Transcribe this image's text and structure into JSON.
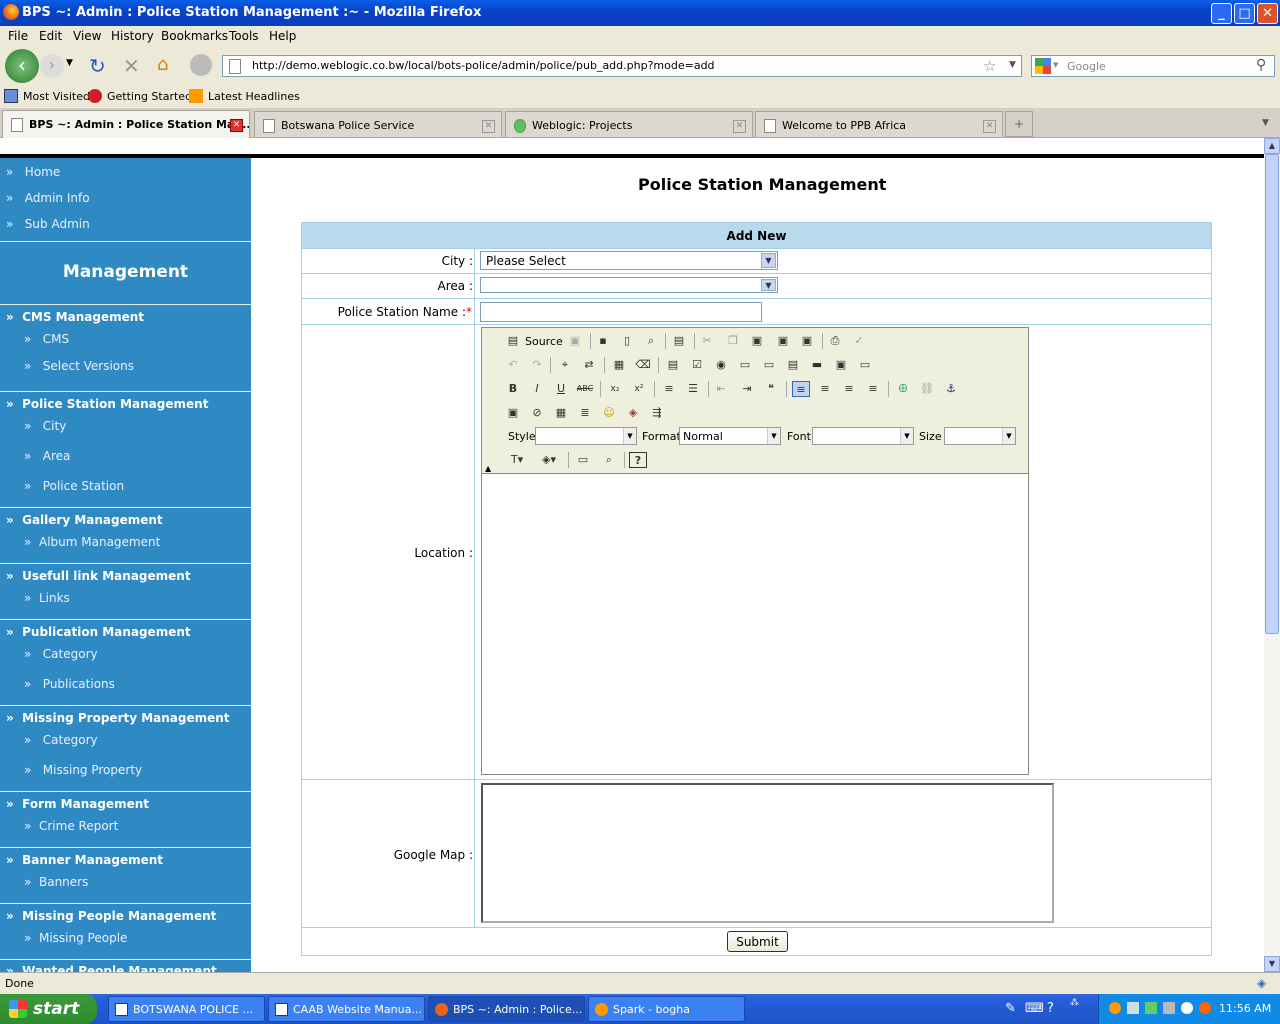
{
  "window": {
    "title": "BPS ~: Admin : Police Station Management :~ - Mozilla Firefox"
  },
  "menu": [
    "File",
    "Edit",
    "View",
    "History",
    "Bookmarks",
    "Tools",
    "Help"
  ],
  "address": {
    "url": "http://demo.weblogic.co.bw/local/bots-police/admin/police/pub_add.php?mode=add",
    "search_placeholder": "Google"
  },
  "bookmarks": [
    "Most Visited",
    "Getting Started",
    "Latest Headlines"
  ],
  "tabs": [
    "BPS ~: Admin : Police Station Man...",
    "Botswana Police Service",
    "Weblogic: Projects",
    "Welcome to PPB Africa"
  ],
  "sidebar": {
    "top": [
      "Home",
      "Admin Info",
      "Sub Admin"
    ],
    "heading": "Management",
    "sections": [
      {
        "title": "CMS Management",
        "items": [
          "CMS",
          "Select Versions"
        ]
      },
      {
        "title": "Police Station Management",
        "items": [
          "City",
          "Area",
          "Police Station"
        ]
      },
      {
        "title": "Gallery Management",
        "items": [
          "Album Management"
        ]
      },
      {
        "title": "Usefull link Management",
        "items": [
          "Links"
        ]
      },
      {
        "title": "Publication Management",
        "items": [
          "Category",
          "Publications"
        ]
      },
      {
        "title": "Missing Property Management",
        "items": [
          "Category",
          "Missing Property"
        ]
      },
      {
        "title": "Form Management",
        "items": [
          "Crime Report"
        ]
      },
      {
        "title": "Banner Management",
        "items": [
          "Banners"
        ]
      },
      {
        "title": "Missing People Management",
        "items": [
          "Missing People"
        ]
      },
      {
        "title": "Wanted People Management",
        "items": []
      }
    ]
  },
  "main": {
    "title": "Police Station Management",
    "form_header": "Add New",
    "city_label": "City :",
    "city_value": "Please Select",
    "area_label": "Area :",
    "area_value": "",
    "name_label": "Police Station Name :",
    "required_mark": "*",
    "location_label": "Location :",
    "map_label": "Google Map :",
    "submit_label": "Submit"
  },
  "editor": {
    "source_label": "Source",
    "style_label": "Style",
    "format_label": "Format",
    "format_value": "Normal",
    "font_label": "Font",
    "size_label": "Size"
  },
  "status": "Done",
  "taskbar": {
    "start": "start",
    "tasks": [
      "BOTSWANA POLICE ...",
      "CAAB Website Manua...",
      "BPS ~: Admin : Police...",
      "Spark - bogha"
    ],
    "clock": "11:56 AM"
  }
}
